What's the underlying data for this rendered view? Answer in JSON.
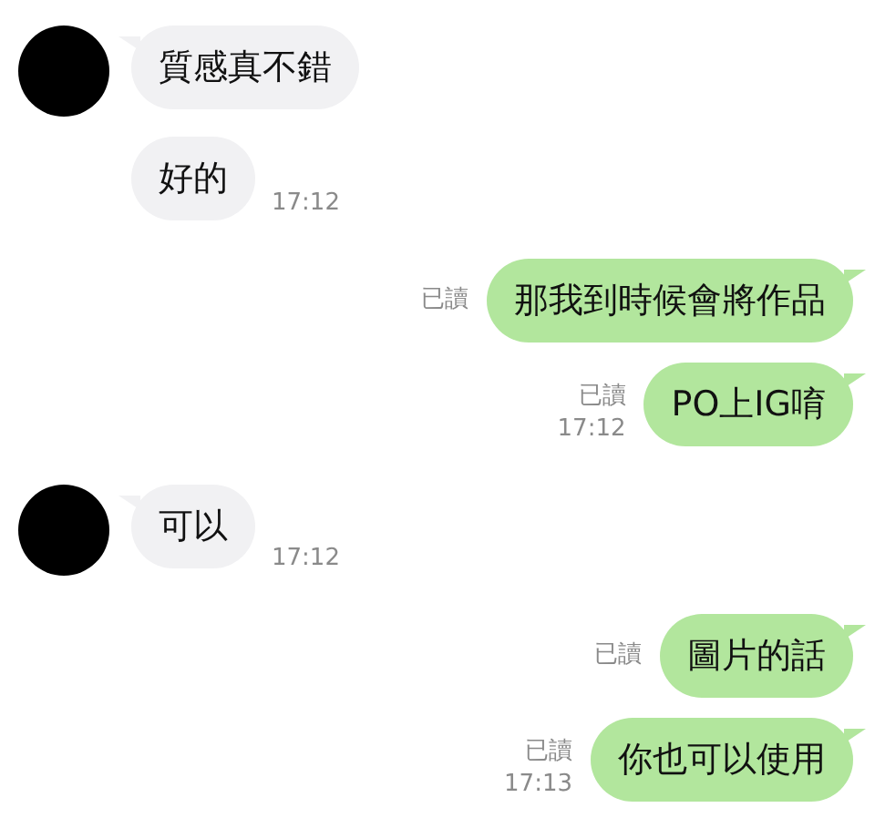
{
  "messages": [
    {
      "kind": "in",
      "text": "質感真不錯",
      "avatar": true
    },
    {
      "kind": "in",
      "text": "好的",
      "avatar": false,
      "time": "17:12"
    },
    {
      "kind": "out",
      "text": "那我到時候會將作品",
      "read": "已讀"
    },
    {
      "kind": "out",
      "text": "PO上IG唷",
      "read": "已讀",
      "time": "17:12"
    },
    {
      "kind": "in",
      "text": "可以",
      "avatar": true,
      "time": "17:12"
    },
    {
      "kind": "out",
      "text": "圖片的話",
      "read": "已讀"
    },
    {
      "kind": "out",
      "text": "你也可以使用",
      "read": "已讀",
      "time": "17:13"
    }
  ]
}
